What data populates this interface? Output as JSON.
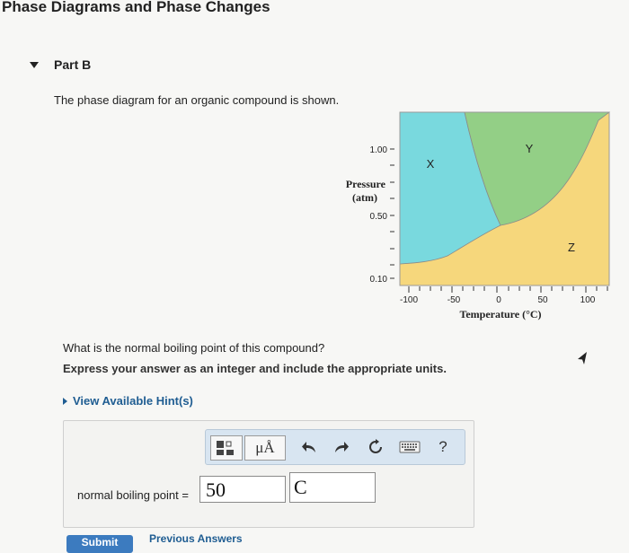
{
  "page": {
    "title": "Phase Diagrams and Phase Changes"
  },
  "part": {
    "label": "Part B"
  },
  "intro": "The phase diagram for an organic compound is shown.",
  "diagram": {
    "ylabel_line1": "Pressure",
    "ylabel_line2": "(atm)",
    "y_ticks": [
      "1.00",
      "0.50",
      "0.10"
    ],
    "x_ticks": [
      "-100",
      "-50",
      "0",
      "50",
      "100"
    ],
    "xlabel": "Temperature (°C)",
    "regions": {
      "X": "X",
      "Y": "Y",
      "Z": "Z"
    },
    "colors": {
      "X": "#79d9de",
      "Y": "#93cf86",
      "Z": "#f6d77c",
      "border": "#999999"
    }
  },
  "question": "What is the normal boiling point of this compound?",
  "instruction": "Express your answer as an integer and include the appropriate units.",
  "hint": "View Available Hint(s)",
  "toolbar": {
    "template_icon": "template-icon",
    "units_label": "μÅ",
    "undo_icon": "undo-icon",
    "redo_icon": "redo-icon",
    "reset_icon": "reset-icon",
    "keyboard_icon": "keyboard-icon",
    "help_label": "?"
  },
  "answer": {
    "label": "normal boiling point =",
    "value": "50",
    "units": "C"
  },
  "buttons": {
    "submit": "Submit",
    "previous": "Previous Answers"
  }
}
